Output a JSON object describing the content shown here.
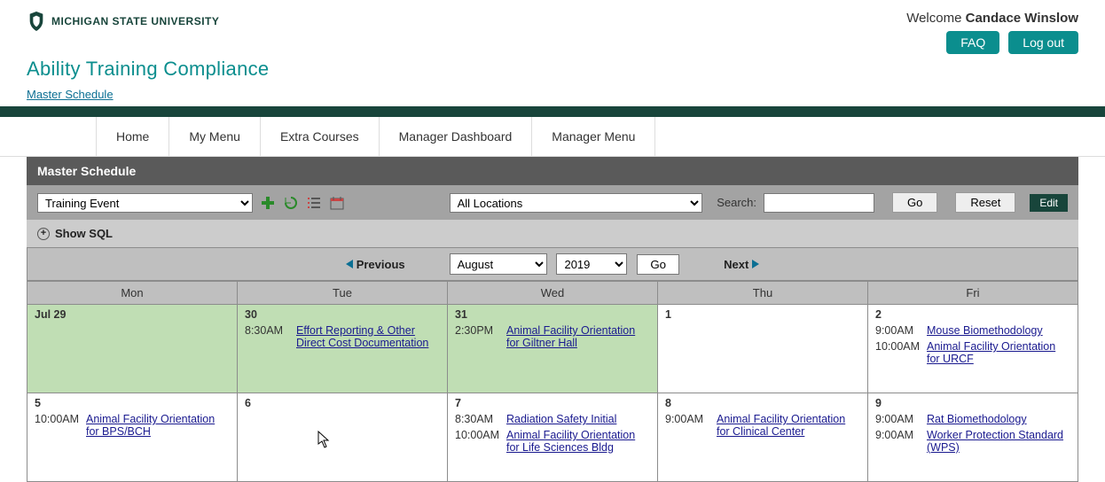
{
  "header": {
    "university": "MICHIGAN STATE UNIVERSITY",
    "welcome_prefix": "Welcome ",
    "user_name": "Candace Winslow",
    "faq_btn": "FAQ",
    "logout_btn": "Log out",
    "app_title": "Ability Training Compliance",
    "breadcrumb": "Master Schedule"
  },
  "nav": {
    "home": "Home",
    "my_menu": "My Menu",
    "extra": "Extra Courses",
    "mgr_dash": "Manager Dashboard",
    "mgr_menu": "Manager Menu"
  },
  "panel": {
    "title": "Master Schedule",
    "event_type": "Training Event",
    "location": "All Locations",
    "search_label": "Search:",
    "go_btn": "Go",
    "reset_btn": "Reset",
    "edit_btn": "Edit",
    "show_sql": "Show SQL"
  },
  "calnav": {
    "prev": "Previous",
    "month": "August",
    "year": "2019",
    "go": "Go",
    "next": "Next"
  },
  "dayheaders": {
    "mon": "Mon",
    "tue": "Tue",
    "wed": "Wed",
    "thu": "Thu",
    "fri": "Fri"
  },
  "cells": {
    "c_0_0": {
      "date": "Jul 29"
    },
    "c_0_1": {
      "date": "30",
      "events": [
        {
          "time": "8:30AM",
          "title": "Effort Reporting & Other Direct Cost Documentation"
        }
      ]
    },
    "c_0_2": {
      "date": "31",
      "events": [
        {
          "time": "2:30PM",
          "title": "Animal Facility Orientation for Giltner Hall"
        }
      ]
    },
    "c_0_3": {
      "date": "1"
    },
    "c_0_4": {
      "date": "2",
      "events": [
        {
          "time": "9:00AM",
          "title": "Mouse Biomethodology"
        },
        {
          "time": "10:00AM",
          "title": "Animal Facility Orientation for URCF"
        }
      ]
    },
    "c_1_0": {
      "date": "5",
      "events": [
        {
          "time": "10:00AM",
          "title": "Animal Facility Orientation for BPS/BCH"
        }
      ]
    },
    "c_1_1": {
      "date": "6"
    },
    "c_1_2": {
      "date": "7",
      "events": [
        {
          "time": "8:30AM",
          "title": "Radiation Safety Initial"
        },
        {
          "time": "10:00AM",
          "title": "Animal Facility Orientation for Life Sciences Bldg"
        }
      ]
    },
    "c_1_3": {
      "date": "8",
      "events": [
        {
          "time": "9:00AM",
          "title": "Animal Facility Orientation for Clinical Center"
        }
      ]
    },
    "c_1_4": {
      "date": "9",
      "events": [
        {
          "time": "9:00AM",
          "title": "Rat Biomethodology"
        },
        {
          "time": "9:00AM",
          "title": "Worker Protection Standard (WPS)"
        }
      ]
    }
  }
}
